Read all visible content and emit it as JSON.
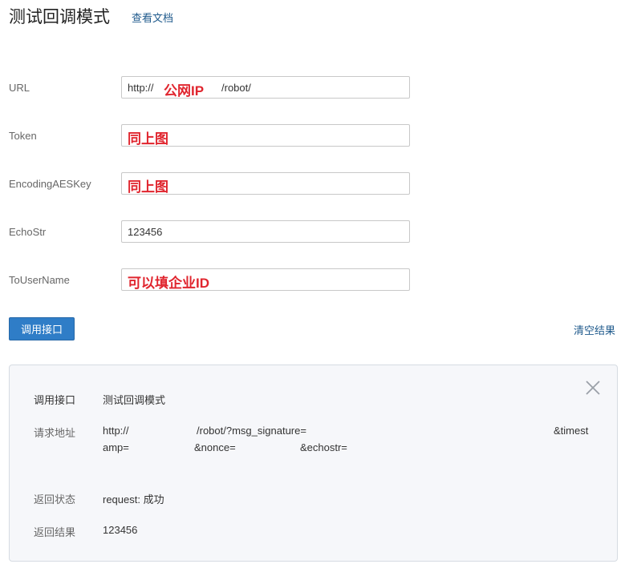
{
  "header": {
    "title": "测试回调模式",
    "doc_link": "查看文档"
  },
  "form": {
    "url": {
      "label": "URL",
      "value_prefix": "http://",
      "note": "公网IP",
      "value_suffix": "/robot/"
    },
    "token": {
      "label": "Token",
      "note": "同上图"
    },
    "aes_key": {
      "label": "EncodingAESKey",
      "note": "同上图"
    },
    "echostr": {
      "label": "EchoStr",
      "value": "123456"
    },
    "to_user": {
      "label": "ToUserName",
      "note": "可以填企业ID"
    }
  },
  "actions": {
    "call_button": "调用接口",
    "clear_link": "清空结果"
  },
  "result": {
    "api_label": "调用接口",
    "api_value": "测试回调模式",
    "url_label": "请求地址",
    "url_line1_a": "http://",
    "url_line1_b": "/robot/?msg_signature=",
    "url_line1_c": "&timest",
    "url_line2_a": "amp=",
    "url_line2_b": "&nonce=",
    "url_line2_c": "&echostr=",
    "status_label": "返回状态",
    "status_value": "request: 成功",
    "result_label": "返回结果",
    "result_value": "123456"
  },
  "colors": {
    "accent": "#2f7dc7",
    "link": "#1f5a8c",
    "annotation": "#e0252e"
  }
}
